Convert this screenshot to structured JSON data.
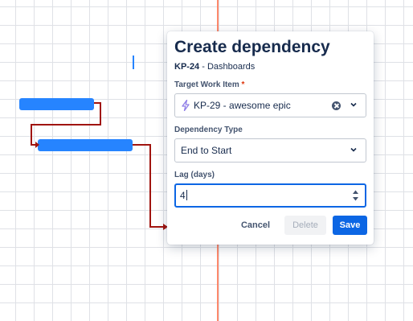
{
  "timeline": {
    "colors": {
      "bar": "#2684ff",
      "link": "#a0140f",
      "today_line": "#ff7452"
    }
  },
  "dialog": {
    "title": "Create dependency",
    "source_key": "KP-24",
    "source_separator": " - ",
    "source_name": "Dashboards",
    "target": {
      "label": "Target Work Item",
      "required_marker": "*",
      "icon": "epic-lightning-icon",
      "value": "KP-29 - awesome epic"
    },
    "dependency_type": {
      "label": "Dependency Type",
      "value": "End to Start"
    },
    "lag": {
      "label": "Lag (days)",
      "value": "4"
    },
    "buttons": {
      "cancel": "Cancel",
      "delete": "Delete",
      "save": "Save"
    },
    "colors": {
      "primary": "#0c66e4",
      "epic_icon": "#8f7ee7",
      "required": "#de350b"
    }
  }
}
